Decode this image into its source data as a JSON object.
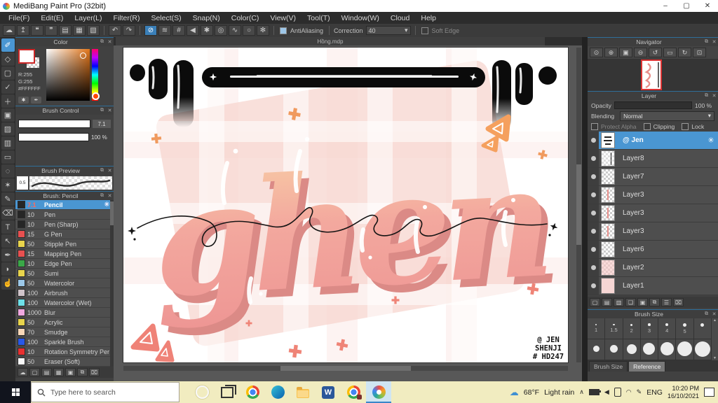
{
  "glyphs": {
    "gear": "✳",
    "close": "✕",
    "popout": "⧉",
    "dropdown": "▾",
    "up": "▲",
    "down": "▼"
  },
  "window": {
    "title": "MediBang Paint Pro (32bit)",
    "minimize": "–",
    "maximize": "▢",
    "close": "✕"
  },
  "menu": {
    "items": [
      "File(F)",
      "Edit(E)",
      "Layer(L)",
      "Filter(R)",
      "Select(S)",
      "Snap(N)",
      "Color(C)",
      "View(V)",
      "Tool(T)",
      "Window(W)",
      "Cloud",
      "Help"
    ]
  },
  "toolbar": {
    "file_icons": [
      {
        "name": "cloud-sync-icon",
        "glyph": "☁"
      },
      {
        "name": "publish-icon",
        "glyph": "↥"
      },
      {
        "name": "comment-icon",
        "glyph": "❝"
      },
      {
        "name": "feedback-icon",
        "glyph": "❞"
      },
      {
        "name": "document-icon",
        "glyph": "▤"
      },
      {
        "name": "panel-layout-icon",
        "glyph": "▦"
      },
      {
        "name": "panel-edit-icon",
        "glyph": "▧"
      }
    ],
    "undo_glyph": "↶",
    "redo_glyph": "↷",
    "snap_icons": [
      {
        "name": "snap-off-icon",
        "glyph": "⊘",
        "selected": true
      },
      {
        "name": "snap-parallel-icon",
        "glyph": "≋"
      },
      {
        "name": "snap-grid-icon",
        "glyph": "#"
      },
      {
        "name": "snap-vanishing-icon",
        "glyph": "◀"
      },
      {
        "name": "snap-radial-icon",
        "glyph": "✱"
      },
      {
        "name": "snap-concentric-icon",
        "glyph": "◎"
      },
      {
        "name": "snap-curve-icon",
        "glyph": "∿"
      },
      {
        "name": "snap-ellipse-icon",
        "glyph": "○"
      },
      {
        "name": "snap-settings-icon",
        "glyph": "✻"
      }
    ],
    "antialiasing_label": "AntiAliasing",
    "correction_label": "Correction",
    "correction_value": "40",
    "soft_edge_label": "Soft Edge"
  },
  "tools": {
    "items": [
      {
        "name": "brush-tool",
        "glyph": "✐",
        "selected": true
      },
      {
        "name": "eraser-tool",
        "glyph": "◇"
      },
      {
        "name": "rounded-select-tool",
        "glyph": "▢"
      },
      {
        "name": "checkmark-tool",
        "glyph": "✓"
      },
      {
        "name": "move-tool",
        "glyph": "＋"
      },
      {
        "name": "fill-rect-tool",
        "glyph": "▣"
      },
      {
        "name": "bucket-tool",
        "glyph": "▨"
      },
      {
        "name": "gradient-tool",
        "glyph": "▥"
      },
      {
        "name": "marquee-select-tool",
        "glyph": "▭"
      },
      {
        "name": "lasso-tool",
        "glyph": "◌"
      },
      {
        "name": "magic-wand-tool",
        "glyph": "✶"
      },
      {
        "name": "select-pen-tool",
        "glyph": "✎"
      },
      {
        "name": "select-eraser-tool",
        "glyph": "⌫"
      },
      {
        "name": "text-tool",
        "glyph": "T"
      },
      {
        "name": "operation-tool",
        "glyph": "↖"
      },
      {
        "name": "eyedropper-tool",
        "glyph": "✒"
      },
      {
        "name": "pen-tool",
        "glyph": "◗"
      },
      {
        "name": "hand-tool",
        "glyph": "☝"
      }
    ]
  },
  "panels": {
    "color": {
      "title": "Color",
      "r_label": "R:255",
      "g_label": "G:255",
      "hex_label": "#FFFFFF"
    },
    "brush_control": {
      "title": "Brush Control",
      "size_value": "7.1",
      "opacity_value": "100 %"
    },
    "brush_preview": {
      "title": "Brush Preview",
      "scale_value": "0.5"
    },
    "brushes": {
      "title": "Brush: Pencil",
      "items": [
        {
          "size": "7.1",
          "name": "Pencil",
          "chip": "#262626",
          "selected": true
        },
        {
          "size": "10",
          "name": "Pen",
          "chip": "#262626"
        },
        {
          "size": "10",
          "name": "Pen (Sharp)",
          "chip": "#262626"
        },
        {
          "size": "15",
          "name": "G Pen",
          "chip": "#e85050"
        },
        {
          "size": "50",
          "name": "Stipple Pen",
          "chip": "#e8d44c"
        },
        {
          "size": "15",
          "name": "Mapping Pen",
          "chip": "#e85050"
        },
        {
          "size": "10",
          "name": "Edge Pen",
          "chip": "#3aa848"
        },
        {
          "size": "50",
          "name": "Sumi",
          "chip": "#e8d44c"
        },
        {
          "size": "50",
          "name": "Watercolor",
          "chip": "#9cc8e8"
        },
        {
          "size": "100",
          "name": "Airbrush",
          "chip": "#cfc3c9"
        },
        {
          "size": "100",
          "name": "Watercolor (Wet)",
          "chip": "#6ee0e8"
        },
        {
          "size": "1000",
          "name": "Blur",
          "chip": "#f0a8e0"
        },
        {
          "size": "50",
          "name": "Acrylic",
          "chip": "#e8d44c"
        },
        {
          "size": "70",
          "name": "Smudge",
          "chip": "#f8d8b8"
        },
        {
          "size": "100",
          "name": "Sparkle Brush",
          "chip": "#2858e8"
        },
        {
          "size": "10",
          "name": "Rotation Symmetry Per",
          "chip": "#e83030"
        },
        {
          "size": "50",
          "name": "Eraser (Soft)",
          "chip": "#f8f8f8"
        }
      ],
      "bottom_icons": [
        {
          "name": "cloud-brush-icon",
          "glyph": "☁"
        },
        {
          "name": "add-brush-icon",
          "glyph": "▢"
        },
        {
          "name": "add-brush-menu-icon",
          "glyph": "▤"
        },
        {
          "name": "edit-brush-icon",
          "glyph": "▦"
        },
        {
          "name": "brush-folder-icon",
          "glyph": "▣"
        },
        {
          "name": "duplicate-brush-icon",
          "glyph": "⧉"
        },
        {
          "name": "delete-brush-icon",
          "glyph": "⌧"
        }
      ]
    },
    "navigator": {
      "title": "Navigator",
      "buttons": [
        {
          "name": "zoom-reset-icon",
          "glyph": "⊙"
        },
        {
          "name": "zoom-in-icon",
          "glyph": "⊕"
        },
        {
          "name": "fit-screen-icon",
          "glyph": "▣"
        },
        {
          "name": "zoom-out-icon",
          "glyph": "⊖"
        },
        {
          "name": "rotate-ccw-icon",
          "glyph": "↺"
        },
        {
          "name": "rotate-reset-icon",
          "glyph": "▭"
        },
        {
          "name": "rotate-cw-icon",
          "glyph": "↻"
        },
        {
          "name": "lock-icon",
          "glyph": "⊡"
        }
      ]
    },
    "layer": {
      "title": "Layer",
      "opacity_label": "Opacity",
      "opacity_value": "100 %",
      "blending_label": "Blending",
      "blending_value": "Normal",
      "protect_alpha_label": "Protect Alpha",
      "clipping_label": "Clipping",
      "lock_label": "Lock",
      "layers": [
        {
          "name": "@ Jen",
          "thumb": "jen",
          "selected": true
        },
        {
          "name": "Layer8",
          "thumb": "line"
        },
        {
          "name": "Layer7",
          "thumb": "checker"
        },
        {
          "name": "Layer3",
          "thumb": "script"
        },
        {
          "name": "Layer3",
          "thumb": "script"
        },
        {
          "name": "Layer3",
          "thumb": "script"
        },
        {
          "name": "Layer6",
          "thumb": "checker"
        },
        {
          "name": "Layer2",
          "thumb": "pinkchecker"
        },
        {
          "name": "Layer1",
          "thumb": "pink"
        }
      ],
      "bottom_icons": [
        {
          "name": "add-layer-icon",
          "glyph": "▢"
        },
        {
          "name": "add-pixel-layer-icon",
          "glyph": "▤"
        },
        {
          "name": "add-halftone-layer-icon",
          "glyph": "▥"
        },
        {
          "name": "add-folder-icon",
          "glyph": "❏"
        },
        {
          "name": "folder-icon",
          "glyph": "▣"
        },
        {
          "name": "duplicate-layer-icon",
          "glyph": "⧉"
        },
        {
          "name": "merge-layer-icon",
          "glyph": "☰"
        },
        {
          "name": "delete-layer-icon",
          "glyph": "⌧"
        }
      ]
    },
    "brush_size": {
      "title": "Brush Size",
      "row1": [
        {
          "label": "1",
          "dot": 2
        },
        {
          "label": "1.5",
          "dot": 2.5
        },
        {
          "label": "2",
          "dot": 3
        },
        {
          "label": "3",
          "dot": 3.5
        },
        {
          "label": "4",
          "dot": 4
        },
        {
          "label": "5",
          "dot": 5
        },
        {
          "label": "",
          "dot": 5
        }
      ],
      "row2": [
        {
          "label": "",
          "dot": 9
        },
        {
          "label": "",
          "dot": 11
        },
        {
          "label": "",
          "dot": 14
        },
        {
          "label": "",
          "dot": 17
        },
        {
          "label": "",
          "dot": 19
        },
        {
          "label": "",
          "dot": 21
        },
        {
          "label": "",
          "dot": 22
        }
      ],
      "tabs": [
        {
          "label": "Brush Size"
        },
        {
          "label": "Reference",
          "selected": true
        }
      ]
    }
  },
  "canvas": {
    "tab_title": "Hồng.mdp",
    "artwork": {
      "word": "ghen",
      "signature_lines": [
        "@ JEN",
        "SHENJI",
        "# HD247"
      ],
      "accent_orange": "#f5a05e",
      "accent_coral": "#ef8277",
      "letter_pink": "#f2a09c"
    }
  },
  "taskbar": {
    "search_placeholder": "Type here to search",
    "word_glyph": "W",
    "weather_temp": "68°F",
    "weather_desc": "Light rain",
    "language": "ENG",
    "time": "10:20 PM",
    "date": "16/10/2021"
  }
}
